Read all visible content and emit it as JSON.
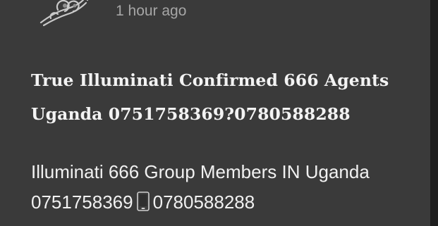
{
  "post": {
    "time_ago": "1 hour ago",
    "title_line1": "True Illuminati Confirmed 666 Agents",
    "title_line2": "Uganda 0751758369?0780588288",
    "body_line1": "Illuminati 666 Group Members IN Uganda",
    "body_phone1": "0751758369",
    "body_phone2": "0780588288",
    "icon": "mobile-phone-icon"
  },
  "colors": {
    "background": "#3a3a3a",
    "timestamp": "#a6a6a6",
    "text": "#f3f3f3"
  }
}
